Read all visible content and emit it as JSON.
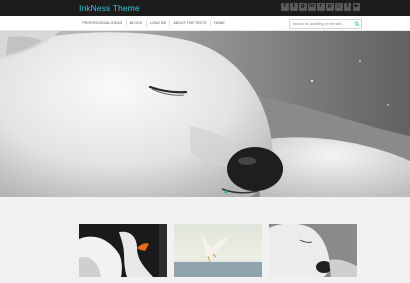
{
  "site": {
    "title": "InkNess Theme"
  },
  "social_icons": [
    {
      "name": "facebook-icon",
      "glyph": "f"
    },
    {
      "name": "twitter-icon",
      "glyph": "t"
    },
    {
      "name": "google-plus-icon",
      "glyph": "g"
    },
    {
      "name": "linkedin-icon",
      "glyph": "in"
    },
    {
      "name": "rss-icon",
      "glyph": "r"
    },
    {
      "name": "pinterest-icon",
      "glyph": "p"
    },
    {
      "name": "instagram-icon",
      "glyph": "◎"
    },
    {
      "name": "tumblr-icon",
      "glyph": "t"
    },
    {
      "name": "youtube-icon",
      "glyph": "▶"
    }
  ],
  "nav": {
    "items": [
      "Professional Ideas",
      "Blogs",
      "Long DB",
      "About the Tests",
      "Home"
    ]
  },
  "search": {
    "placeholder": "Search for anything on the site..."
  },
  "colors": {
    "accent": "#35c7d6",
    "topbar": "#1c1c1c"
  }
}
